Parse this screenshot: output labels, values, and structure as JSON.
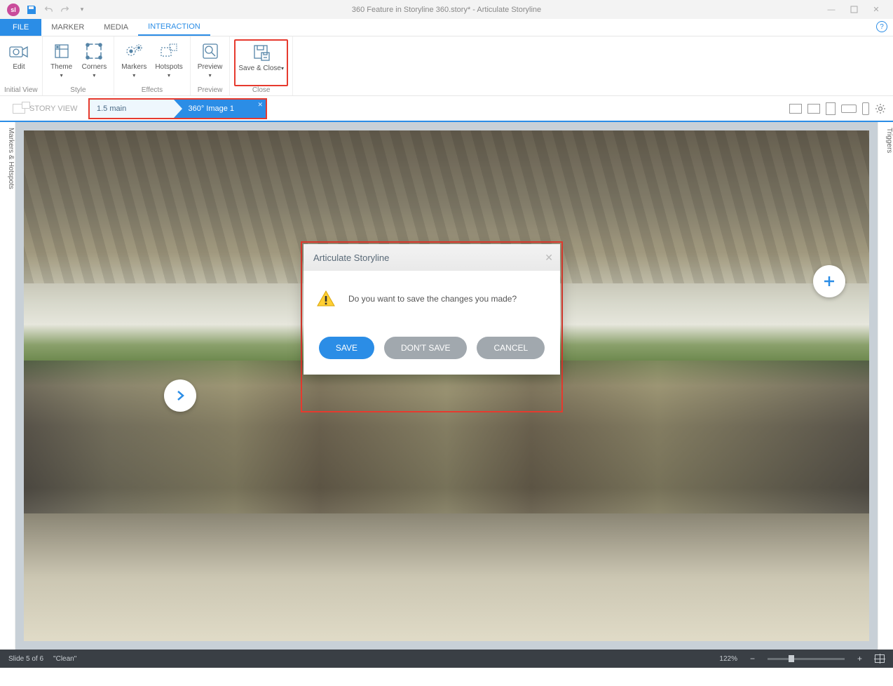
{
  "title": "360 Feature in Storyline 360.story* -  Articulate Storyline",
  "tabs": {
    "file": "FILE",
    "marker": "MARKER",
    "media": "MEDIA",
    "interaction": "INTERACTION"
  },
  "ribbon": {
    "initial_view": {
      "edit": "Edit",
      "group": "Initial View"
    },
    "style": {
      "theme": "Theme",
      "corners": "Corners",
      "group": "Style"
    },
    "effects": {
      "markers": "Markers",
      "hotspots": "Hotspots",
      "group": "Effects"
    },
    "preview": {
      "preview": "Preview",
      "group": "Preview"
    },
    "close": {
      "save_close": "Save & Close",
      "group": "Close"
    }
  },
  "crumbs": {
    "story_view": "STORY VIEW",
    "c1": "1.5 main",
    "c2": "360° Image 1"
  },
  "side_left": "Markers & Hotspots",
  "side_right": "Triggers",
  "dialog": {
    "title": "Articulate Storyline",
    "message": "Do you want to save the changes you made?",
    "save": "SAVE",
    "dont_save": "DON'T SAVE",
    "cancel": "CANCEL"
  },
  "status": {
    "slide": "Slide 5 of 6",
    "layout": "\"Clean\"",
    "zoom": "122%"
  }
}
